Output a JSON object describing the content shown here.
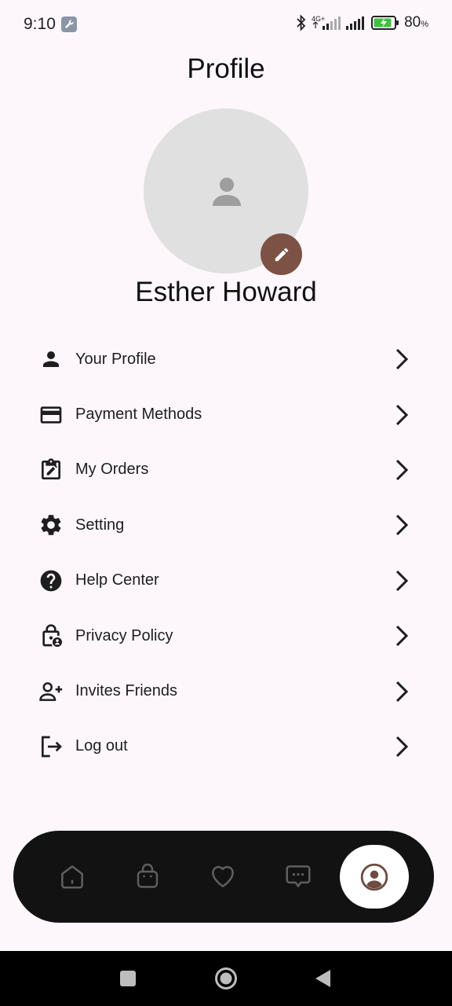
{
  "status_bar": {
    "time": "9:10",
    "network_label": "4G+",
    "battery_percent": "80",
    "battery_unit": "%"
  },
  "header": {
    "title": "Profile"
  },
  "profile": {
    "name": "Esther Howard"
  },
  "menu": {
    "items": [
      {
        "label": "Your Profile",
        "icon": "person-icon"
      },
      {
        "label": "Payment Methods",
        "icon": "credit-card-icon"
      },
      {
        "label": "My Orders",
        "icon": "clipboard-edit-icon"
      },
      {
        "label": "Setting",
        "icon": "gear-icon"
      },
      {
        "label": "Help Center",
        "icon": "help-icon"
      },
      {
        "label": "Privacy Policy",
        "icon": "lock-user-icon"
      },
      {
        "label": "Invites Friends",
        "icon": "add-person-icon"
      },
      {
        "label": "Log out",
        "icon": "logout-icon"
      }
    ]
  },
  "bottom_nav": {
    "items": [
      "home-icon",
      "bag-icon",
      "heart-icon",
      "chat-icon",
      "profile-icon"
    ],
    "active": "profile-icon"
  },
  "colors": {
    "background": "#fdf7fc",
    "accent": "#7b5244",
    "nav_background": "#121212",
    "avatar_placeholder": "#e0e0e0"
  }
}
